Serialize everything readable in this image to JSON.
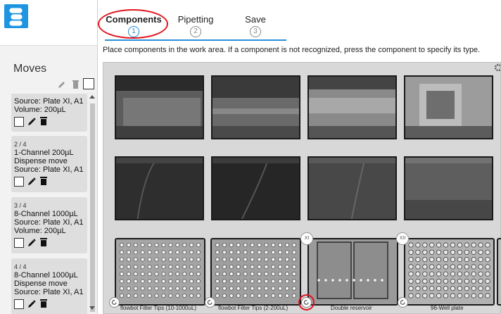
{
  "app": {
    "logo_icon": "opentrons-style-logo-icon",
    "accent_color": "#1e95e0",
    "highlight_color": "#e0141e"
  },
  "steps": {
    "items": [
      {
        "label": "Components",
        "number": "1",
        "active": true
      },
      {
        "label": "Pipetting",
        "number": "2",
        "active": false
      },
      {
        "label": "Save",
        "number": "3",
        "active": false
      }
    ],
    "instruction": "Place components in the work area. If a component is not recognized, press the component to specify its type."
  },
  "sidebar": {
    "title": "Moves",
    "tool_icons": [
      "pencil-icon",
      "trash-icon",
      "checkbox-icon"
    ],
    "moves": [
      {
        "lines": [
          "Source: Plate XI, A1",
          "Volume: 200µL"
        ]
      },
      {
        "num": "2 / 4",
        "lines": [
          "1-Channel 200µL",
          "Dispense move",
          "Source: Plate XI, A1"
        ]
      },
      {
        "num": "3 / 4",
        "lines": [
          "8-Channel 1000µL",
          "Source: Plate XI, A1",
          "Volume: 200µL"
        ]
      },
      {
        "num": "4 / 4",
        "lines": [
          "8-Channel 1000µL",
          "Dispense move",
          "Source: Plate XI, A1"
        ]
      }
    ]
  },
  "workarea": {
    "settings_icon": "gear-icon",
    "slot_labels": [
      "XI",
      "XII"
    ],
    "components": [
      {
        "label": "flowbot Filter Tips (10-1000uL)"
      },
      {
        "label": "flowbot Filter Tips (2-200uL)"
      },
      {
        "label": "Double reservoir"
      },
      {
        "label": "96-Well plate"
      }
    ]
  }
}
